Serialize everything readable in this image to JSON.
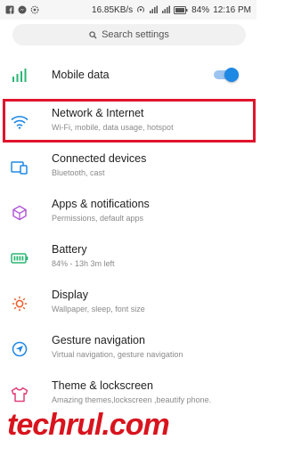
{
  "status_bar": {
    "speed": "16.85KB/s",
    "battery": "84%",
    "time": "12:16 PM"
  },
  "search": {
    "placeholder": "Search settings"
  },
  "items": [
    {
      "title": "Mobile data",
      "subtitle": "",
      "icon": "signal-icon",
      "color": "#2bb673",
      "toggle_on": true
    },
    {
      "title": "Network & Internet",
      "subtitle": "Wi-Fi, mobile, data usage, hotspot",
      "icon": "wifi-icon",
      "color": "#1e88e5"
    },
    {
      "title": "Connected devices",
      "subtitle": "Bluetooth, cast",
      "icon": "devices-icon",
      "color": "#1e88e5"
    },
    {
      "title": "Apps & notifications",
      "subtitle": "Permissions, default apps",
      "icon": "apps-icon",
      "color": "#b05ad8"
    },
    {
      "title": "Battery",
      "subtitle": "84% - 13h 3m left",
      "icon": "battery-icon",
      "color": "#2bb673"
    },
    {
      "title": "Display",
      "subtitle": "Wallpaper, sleep, font size",
      "icon": "brightness-icon",
      "color": "#f05a28"
    },
    {
      "title": "Gesture navigation",
      "subtitle": "Virtual navigation, gesture navigation",
      "icon": "gesture-icon",
      "color": "#1e88e5"
    },
    {
      "title": "Theme & lockscreen",
      "subtitle": "Amazing themes,lockscreen ,beautify phone.",
      "icon": "theme-icon",
      "color": "#e0407a"
    }
  ],
  "watermark": "techrul.com"
}
